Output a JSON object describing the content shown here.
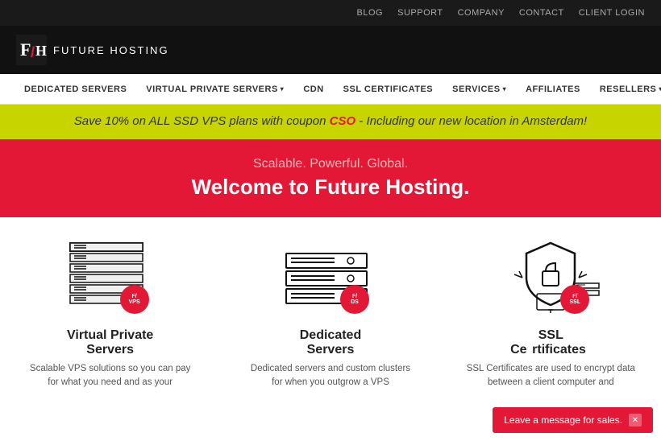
{
  "topbar": {
    "links": [
      "BLOG",
      "SUPPORT",
      "COMPANY",
      "CONTACT",
      "CLIENT LOGIN"
    ]
  },
  "header": {
    "logo_text": "FUTURE HOSTING"
  },
  "nav": {
    "items": [
      {
        "label": "DEDICATED SERVERS",
        "has_arrow": false
      },
      {
        "label": "VIRTUAL PRIVATE SERVERS",
        "has_arrow": true
      },
      {
        "label": "CDN",
        "has_arrow": false
      },
      {
        "label": "SSL CERTIFICATES",
        "has_arrow": false
      },
      {
        "label": "SERVICES",
        "has_arrow": true
      },
      {
        "label": "AFFILIATES",
        "has_arrow": false
      },
      {
        "label": "RESELLERS",
        "has_arrow": true
      }
    ]
  },
  "promo": {
    "text_before": "Save 10% on ALL SSD VPS plans with coupon ",
    "coupon": "CSO",
    "text_after": " - Including our new location in Amsterdam!"
  },
  "hero": {
    "subtitle": "Scalable. Powerful. Global.",
    "title": "Welcome to Future Hosting."
  },
  "features": [
    {
      "id": "vps",
      "title": "Virtual Private\nServers",
      "desc": "Scalable VPS solutions so you can pay for what you need and as your",
      "badge": "F/vps"
    },
    {
      "id": "dedicated",
      "title": "Dedicated\nServers",
      "desc": "Dedicated servers and custom clusters for when you outgrow a VPS",
      "badge": "F/DS"
    },
    {
      "id": "ssl",
      "title": "SSL\nCertificates",
      "desc": "SSL Certificates are used to encrypt data between a client computer and",
      "badge": "F/SSL"
    }
  ],
  "sales_chat": {
    "label": "Leave a message for sales."
  }
}
